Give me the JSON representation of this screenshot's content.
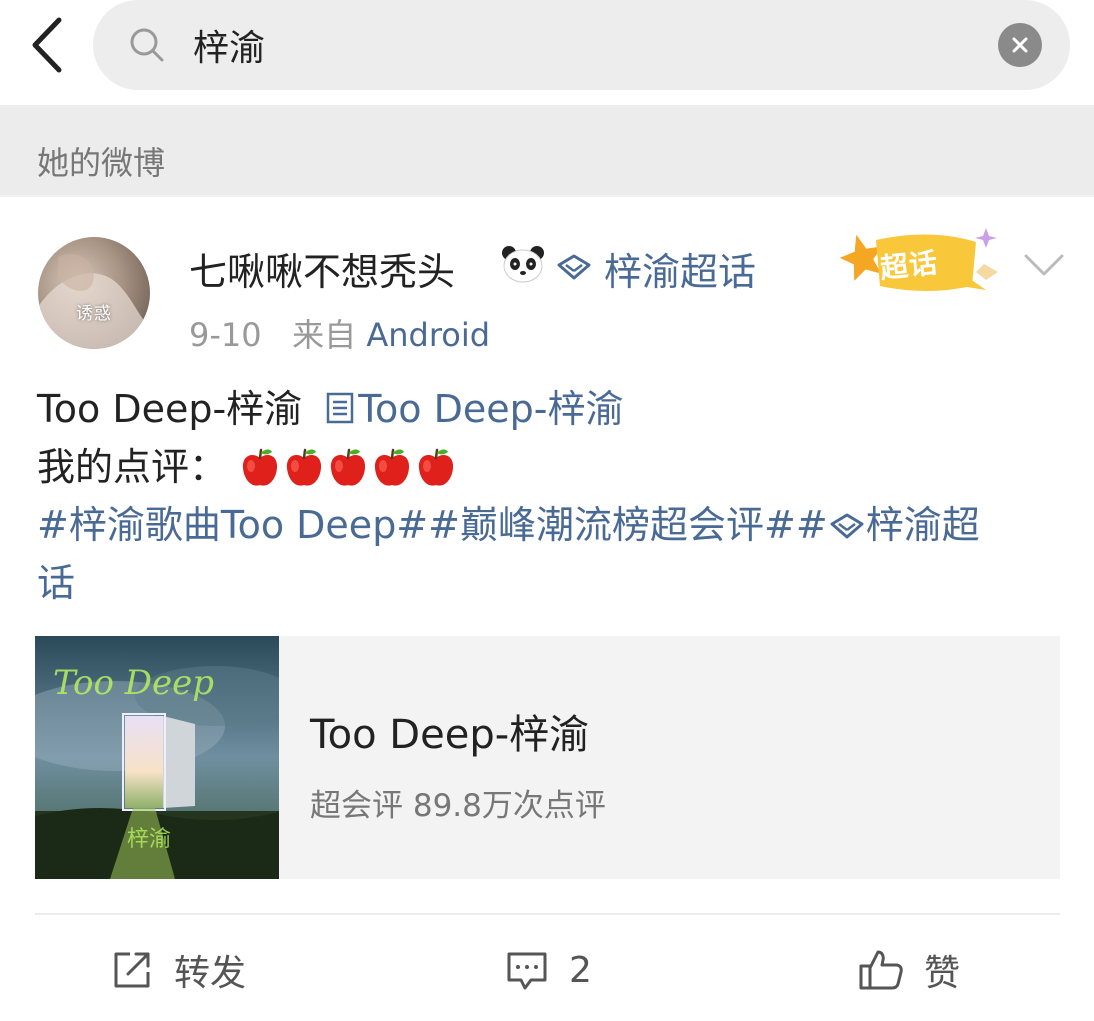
{
  "search": {
    "query": "梓渝"
  },
  "section": {
    "title": "她的微博"
  },
  "post": {
    "avatar_caption": "诱惑",
    "user_name": "七啾啾不想秃头",
    "topic_link": "梓渝超话",
    "badge_text": "超话",
    "date": "9-10",
    "from_label": "来自",
    "source": "Android",
    "body": {
      "song_line_text": "Too Deep-梓渝",
      "song_line_link": "Too Deep-梓渝",
      "review_label": "我的点评：",
      "apple_count": 5,
      "hashtag_1": "#梓渝歌曲Too Deep#",
      "hashtag_2": "#巅峰潮流榜超会评#",
      "hashtag_3_part1": "梓渝超",
      "hashtag_3_part2": "话",
      "hashtag_3_prefix": "#"
    },
    "music_card": {
      "cover_title": "Too Deep",
      "cover_artist": "梓渝",
      "title": "Too Deep-梓渝",
      "subtitle": "超会评 89.8万次点评"
    },
    "actions": {
      "forward_label": "转发",
      "comment_count": "2",
      "like_label": "赞"
    }
  },
  "colors": {
    "link": "#4a6a96",
    "badge": "#f7b733"
  }
}
